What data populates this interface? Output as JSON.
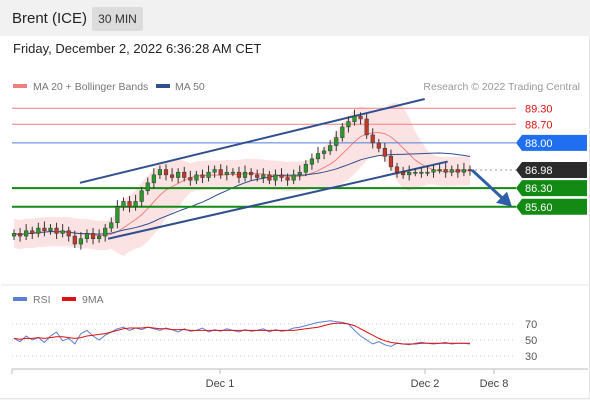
{
  "header": {
    "title": "Brent (ICE)",
    "timeframe": "30 MIN"
  },
  "timestamp": "Friday, December 2, 2022 6:36:28 AM CET",
  "legend": {
    "bollinger_label": "MA 20 + Bollinger Bands",
    "ma50_label": "MA 50",
    "bollinger_color": "#f08080",
    "ma50_color": "#2f4f8f"
  },
  "copyright": "Research © 2022 Trading Central",
  "rsi_legend": {
    "rsi_label": "RSI",
    "ma_label": "9MA",
    "rsi_color": "#5b7fd6",
    "ma_color": "#d11"
  },
  "chart_data": {
    "type": "candlestick",
    "x_labels": [
      "Dec 1",
      "Dec 2",
      "Dec 8"
    ],
    "price_levels": [
      {
        "label": "89.30",
        "value": 89.3,
        "kind": "resistance"
      },
      {
        "label": "88.70",
        "value": 88.7,
        "kind": "resistance"
      },
      {
        "label": "88.00",
        "value": 88.0,
        "kind": "pivot"
      },
      {
        "label": "86.98",
        "value": 86.98,
        "kind": "last"
      },
      {
        "label": "86.30",
        "value": 86.3,
        "kind": "support"
      },
      {
        "label": "85.60",
        "value": 85.6,
        "kind": "support"
      }
    ],
    "ylim": [
      83.3,
      89.8
    ],
    "closes": [
      84.6,
      84.5,
      84.7,
      84.6,
      84.8,
      84.7,
      84.8,
      84.6,
      84.7,
      84.5,
      84.2,
      84.4,
      84.6,
      84.4,
      84.5,
      84.8,
      85.0,
      85.6,
      85.8,
      85.6,
      85.8,
      86.2,
      86.5,
      86.8,
      87.0,
      86.8,
      86.7,
      86.9,
      86.7,
      86.6,
      86.8,
      86.7,
      86.9,
      87.0,
      86.8,
      86.9,
      86.9,
      86.7,
      86.9,
      86.8,
      86.7,
      86.8,
      86.6,
      86.8,
      86.7,
      86.6,
      86.8,
      86.9,
      87.2,
      87.4,
      87.6,
      87.7,
      87.9,
      88.2,
      88.6,
      88.8,
      89.0,
      88.9,
      88.3,
      88.0,
      87.8,
      87.5,
      87.1,
      86.9,
      86.8,
      86.9,
      86.9,
      86.9,
      86.9,
      87.0,
      87.0,
      86.9,
      87.0,
      86.9,
      87.0,
      86.98
    ],
    "trendlines": [
      {
        "name": "upper channel",
        "from": [
          0.09,
          86.5
        ],
        "to": [
          0.765,
          89.65
        ]
      },
      {
        "name": "lower channel",
        "from": [
          0.145,
          84.4
        ],
        "to": [
          0.81,
          87.3
        ]
      }
    ],
    "projection": {
      "from": 86.98,
      "to": 85.6
    },
    "rsi": {
      "levels": [
        70,
        50,
        30
      ],
      "ylim": [
        20,
        85
      ],
      "values": [
        52,
        48,
        55,
        50,
        53,
        47,
        55,
        60,
        49,
        52,
        45,
        58,
        62,
        55,
        50,
        56,
        60,
        64,
        66,
        62,
        65,
        63,
        66,
        64,
        62,
        65,
        63,
        60,
        64,
        61,
        62,
        65,
        60,
        63,
        61,
        64,
        62,
        60,
        63,
        61,
        62,
        64,
        60,
        63,
        61,
        62,
        65,
        66,
        68,
        70,
        72,
        73,
        74,
        73,
        72,
        70,
        62,
        55,
        50,
        45,
        48,
        44,
        42,
        46,
        45,
        44,
        46,
        47,
        46,
        45,
        46,
        47,
        45,
        46,
        46,
        45
      ],
      "ma": [
        52,
        51,
        52,
        52,
        53,
        52,
        53,
        54,
        54,
        53,
        52,
        53,
        55,
        56,
        57,
        58,
        60,
        62,
        64,
        65,
        65,
        65,
        66,
        65,
        64,
        64,
        63,
        63,
        63,
        62,
        62,
        62,
        62,
        62,
        62,
        62,
        62,
        62,
        62,
        62,
        62,
        62,
        62,
        62,
        62,
        62,
        62,
        63,
        64,
        65,
        66,
        68,
        70,
        71,
        71,
        70,
        68,
        64,
        60,
        56,
        52,
        49,
        47,
        46,
        45,
        45,
        45,
        46,
        46,
        46,
        46,
        46,
        46,
        46,
        46,
        46
      ]
    }
  }
}
